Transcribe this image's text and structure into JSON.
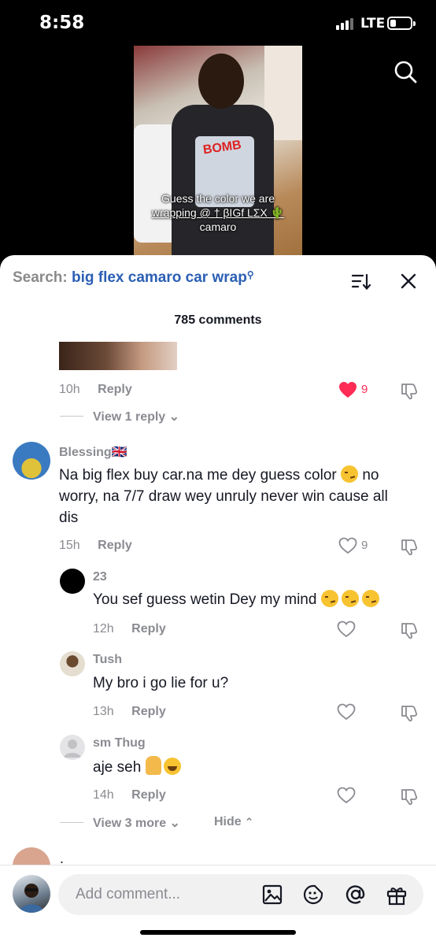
{
  "status_bar": {
    "time": "8:58",
    "network": "LTE"
  },
  "video": {
    "caption_line1": "Guess the color we are",
    "caption_line2": "wrapping @ † βIGf LΣX 🌵",
    "caption_line3": "camaro",
    "shirt_print": "BOMB"
  },
  "sheet": {
    "search_label": "Search:",
    "search_query": "big flex camaro car wrap",
    "comment_count": "785 comments"
  },
  "top_comment": {
    "time": "10h",
    "reply": "Reply",
    "likes": "9",
    "view_replies": "View 1 reply"
  },
  "comments": [
    {
      "username": "Blessing🇬🇧",
      "text_line1": "Na big flex buy car.na me dey guess color",
      "text_line1_tail": "no",
      "text_line2": "worry, na 7/7 draw wey unruly never win cause all",
      "text_line3": "dis",
      "time": "15h",
      "reply": "Reply",
      "likes": "9"
    }
  ],
  "replies": [
    {
      "username": "23",
      "text": "You sef guess wetin Dey my mind",
      "time": "12h",
      "reply": "Reply"
    },
    {
      "username": "Tush",
      "text": "My bro i go lie for u?",
      "time": "13h",
      "reply": "Reply"
    },
    {
      "username": "sm Thug",
      "text": "aje seh",
      "time": "14h",
      "reply": "Reply"
    }
  ],
  "thread_footer": {
    "view_more": "View 3 more",
    "hide": "Hide"
  },
  "next_comment": {
    "username_partial": "."
  },
  "composer": {
    "placeholder": "Add comment..."
  },
  "colors": {
    "accent": "#fe2c55",
    "link": "#2b5fb4",
    "text": "#161823",
    "muted": "#8a8b91"
  },
  "icons": [
    "search-icon",
    "sort-icon",
    "close-icon",
    "heart-icon",
    "dislike-icon",
    "image-icon",
    "sticker-icon",
    "mention-icon",
    "gift-icon"
  ]
}
